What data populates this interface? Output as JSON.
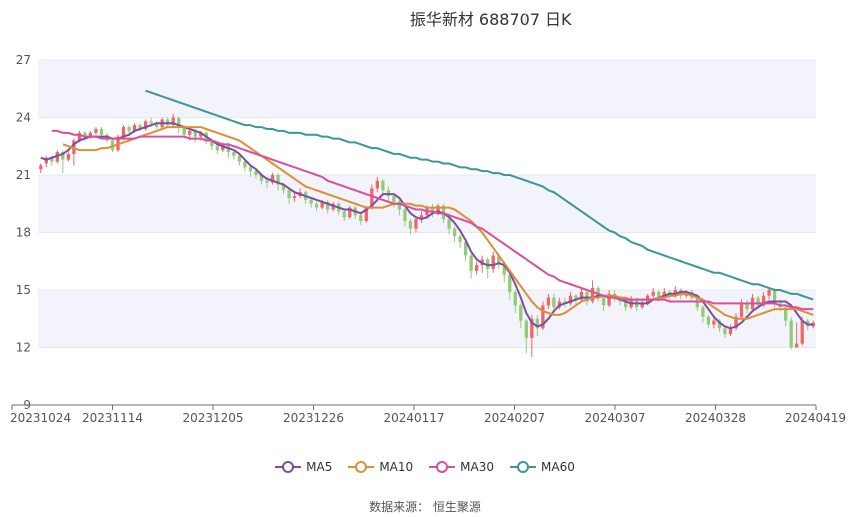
{
  "header": {
    "title": "振华新材 688707",
    "period": "日K"
  },
  "source": "数据来源： 恒生聚源",
  "colors": {
    "up": "#ee6666",
    "down": "#91cc75",
    "MA5": "#7b4ea3",
    "MA10": "#e08e35",
    "MA30": "#d94fa0",
    "MA60": "#3e9698",
    "grid_band": "#f3f4fb"
  },
  "chart_data": {
    "type": "candlestick",
    "title": "振华新材 688707",
    "subtitle": "日K",
    "ylim": [
      9,
      27
    ],
    "y_ticks": [
      "9",
      "12",
      "15",
      "18",
      "21",
      "24",
      "27"
    ],
    "x_ticks": [
      "20231024",
      "20231114",
      "20231205",
      "20231226",
      "20240117",
      "20240207",
      "20240307",
      "20240328",
      "20240419"
    ],
    "candles": [
      [
        21.3,
        21.5,
        21.1,
        21.6
      ],
      [
        21.6,
        21.9,
        21.4,
        22.0
      ],
      [
        21.9,
        21.7,
        21.5,
        22.0
      ],
      [
        21.7,
        22.2,
        21.6,
        22.3
      ],
      [
        22.2,
        21.8,
        21.1,
        22.3
      ],
      [
        21.8,
        22.1,
        21.7,
        22.3
      ],
      [
        22.1,
        22.8,
        21.5,
        22.9
      ],
      [
        22.8,
        23.2,
        22.7,
        23.3
      ],
      [
        23.2,
        23.0,
        22.8,
        23.3
      ],
      [
        23.0,
        23.2,
        22.9,
        23.3
      ],
      [
        23.2,
        23.4,
        23.1,
        23.5
      ],
      [
        23.4,
        23.1,
        22.9,
        23.5
      ],
      [
        23.1,
        22.8,
        22.7,
        23.2
      ],
      [
        22.8,
        22.3,
        22.2,
        22.9
      ],
      [
        22.3,
        23.0,
        22.2,
        23.1
      ],
      [
        23.0,
        23.5,
        22.9,
        23.6
      ],
      [
        23.5,
        23.3,
        23.1,
        23.6
      ],
      [
        23.3,
        23.6,
        23.2,
        23.7
      ],
      [
        23.6,
        23.4,
        23.3,
        23.7
      ],
      [
        23.4,
        23.8,
        23.3,
        23.9
      ],
      [
        23.8,
        23.7,
        23.5,
        24.0
      ],
      [
        23.7,
        23.5,
        23.4,
        23.8
      ],
      [
        23.5,
        23.9,
        23.4,
        24.0
      ],
      [
        23.9,
        23.6,
        23.5,
        24.0
      ],
      [
        23.6,
        24.0,
        23.5,
        24.2
      ],
      [
        24.0,
        23.5,
        23.2,
        24.0
      ],
      [
        23.5,
        23.1,
        22.9,
        23.6
      ],
      [
        23.1,
        23.3,
        22.8,
        23.4
      ],
      [
        23.3,
        23.0,
        22.7,
        23.4
      ],
      [
        23.0,
        23.2,
        22.8,
        23.3
      ],
      [
        23.2,
        22.8,
        22.6,
        23.3
      ],
      [
        22.8,
        22.5,
        22.3,
        22.9
      ],
      [
        22.5,
        22.3,
        22.1,
        22.6
      ],
      [
        22.3,
        22.6,
        22.2,
        22.7
      ],
      [
        22.6,
        22.2,
        21.9,
        22.7
      ],
      [
        22.2,
        22.0,
        21.8,
        22.3
      ],
      [
        22.0,
        21.7,
        21.5,
        22.1
      ],
      [
        21.7,
        21.4,
        21.2,
        21.8
      ],
      [
        21.4,
        21.2,
        20.9,
        21.5
      ],
      [
        21.2,
        21.0,
        20.8,
        21.3
      ],
      [
        21.0,
        20.7,
        20.5,
        21.1
      ],
      [
        20.7,
        20.6,
        20.3,
        20.9
      ],
      [
        20.6,
        21.0,
        20.5,
        21.1
      ],
      [
        21.0,
        20.5,
        20.2,
        21.1
      ],
      [
        20.5,
        20.2,
        20.0,
        20.6
      ],
      [
        20.2,
        19.8,
        19.5,
        20.3
      ],
      [
        19.8,
        19.9,
        19.6,
        20.1
      ],
      [
        19.9,
        20.1,
        19.8,
        20.3
      ],
      [
        20.1,
        19.7,
        19.5,
        20.2
      ],
      [
        19.7,
        19.5,
        19.3,
        19.8
      ],
      [
        19.5,
        19.3,
        19.1,
        19.6
      ],
      [
        19.3,
        19.6,
        19.2,
        19.7
      ],
      [
        19.6,
        19.2,
        19.0,
        19.7
      ],
      [
        19.2,
        19.5,
        19.1,
        19.6
      ],
      [
        19.5,
        19.1,
        18.9,
        19.6
      ],
      [
        19.1,
        18.8,
        18.6,
        19.2
      ],
      [
        18.8,
        19.3,
        18.7,
        19.4
      ],
      [
        19.3,
        18.9,
        18.7,
        19.4
      ],
      [
        18.9,
        18.6,
        18.4,
        19.0
      ],
      [
        18.6,
        19.3,
        18.5,
        19.4
      ],
      [
        19.3,
        20.3,
        19.2,
        20.5
      ],
      [
        20.3,
        20.7,
        20.1,
        20.9
      ],
      [
        20.7,
        20.2,
        19.9,
        20.8
      ],
      [
        20.2,
        19.9,
        19.6,
        20.4
      ],
      [
        19.9,
        19.6,
        19.3,
        20.0
      ],
      [
        19.6,
        19.2,
        18.9,
        19.7
      ],
      [
        19.2,
        18.6,
        18.3,
        19.3
      ],
      [
        18.6,
        18.2,
        17.9,
        18.7
      ],
      [
        18.2,
        18.7,
        18.0,
        18.8
      ],
      [
        18.7,
        18.9,
        18.5,
        19.1
      ],
      [
        18.9,
        19.3,
        18.7,
        19.4
      ],
      [
        19.3,
        19.0,
        18.8,
        19.5
      ],
      [
        19.0,
        19.4,
        18.9,
        19.5
      ],
      [
        19.4,
        18.7,
        18.5,
        19.5
      ],
      [
        18.7,
        18.2,
        17.9,
        18.8
      ],
      [
        18.2,
        17.8,
        17.5,
        18.3
      ],
      [
        17.8,
        17.5,
        17.2,
        17.9
      ],
      [
        17.5,
        16.8,
        16.5,
        17.6
      ],
      [
        16.8,
        16.0,
        15.6,
        16.9
      ],
      [
        16.0,
        16.3,
        15.8,
        16.5
      ],
      [
        16.3,
        16.6,
        15.9,
        16.8
      ],
      [
        16.6,
        16.1,
        15.6,
        16.7
      ],
      [
        16.1,
        16.8,
        15.9,
        17.0
      ],
      [
        16.8,
        16.4,
        16.1,
        16.9
      ],
      [
        16.4,
        15.8,
        15.4,
        16.5
      ],
      [
        15.8,
        14.9,
        14.5,
        15.9
      ],
      [
        14.9,
        14.2,
        13.8,
        15.0
      ],
      [
        14.2,
        13.4,
        13.0,
        14.3
      ],
      [
        13.4,
        12.5,
        11.7,
        13.5
      ],
      [
        12.5,
        13.5,
        11.5,
        13.7
      ],
      [
        13.5,
        13.0,
        12.6,
        13.7
      ],
      [
        13.0,
        14.2,
        12.9,
        14.4
      ],
      [
        14.2,
        14.6,
        14.0,
        14.8
      ],
      [
        14.6,
        14.1,
        13.9,
        14.8
      ],
      [
        14.1,
        14.4,
        14.0,
        14.6
      ],
      [
        14.4,
        14.3,
        14.1,
        14.6
      ],
      [
        14.3,
        14.7,
        14.2,
        14.9
      ],
      [
        14.7,
        14.5,
        14.2,
        14.8
      ],
      [
        14.5,
        14.9,
        14.4,
        15.1
      ],
      [
        14.9,
        14.4,
        14.2,
        15.0
      ],
      [
        14.4,
        15.1,
        14.3,
        15.5
      ],
      [
        15.1,
        14.6,
        14.4,
        15.2
      ],
      [
        14.6,
        14.2,
        13.9,
        14.7
      ],
      [
        14.2,
        14.8,
        14.1,
        15.0
      ],
      [
        14.8,
        14.6,
        14.4,
        15.0
      ],
      [
        14.6,
        14.4,
        14.2,
        14.7
      ],
      [
        14.4,
        14.1,
        13.9,
        14.5
      ],
      [
        14.1,
        14.5,
        14.0,
        14.7
      ],
      [
        14.5,
        14.1,
        13.9,
        14.6
      ],
      [
        14.1,
        14.3,
        14.0,
        14.5
      ],
      [
        14.3,
        14.7,
        14.2,
        14.8
      ],
      [
        14.7,
        14.9,
        14.5,
        15.1
      ],
      [
        14.9,
        14.6,
        14.4,
        15.0
      ],
      [
        14.6,
        14.9,
        14.5,
        15.1
      ],
      [
        14.9,
        14.7,
        14.5,
        15.0
      ],
      [
        14.7,
        15.0,
        14.6,
        15.2
      ],
      [
        15.0,
        14.7,
        14.5,
        15.1
      ],
      [
        14.7,
        14.9,
        14.6,
        15.0
      ],
      [
        14.9,
        14.6,
        14.4,
        15.0
      ],
      [
        14.6,
        14.1,
        13.9,
        14.7
      ],
      [
        14.1,
        13.6,
        13.3,
        14.2
      ],
      [
        13.6,
        13.2,
        13.0,
        13.7
      ],
      [
        13.2,
        13.4,
        13.0,
        13.6
      ],
      [
        13.4,
        13.0,
        12.8,
        13.5
      ],
      [
        13.0,
        12.7,
        12.5,
        13.1
      ],
      [
        12.7,
        13.0,
        12.6,
        13.2
      ],
      [
        13.0,
        13.6,
        12.9,
        13.8
      ],
      [
        13.6,
        14.3,
        13.5,
        14.5
      ],
      [
        14.3,
        14.0,
        13.8,
        14.5
      ],
      [
        14.0,
        14.6,
        13.9,
        14.8
      ],
      [
        14.6,
        14.2,
        14.0,
        14.7
      ],
      [
        14.2,
        14.7,
        14.1,
        14.9
      ],
      [
        14.7,
        15.0,
        14.5,
        15.1
      ],
      [
        15.0,
        14.3,
        14.1,
        15.1
      ],
      [
        14.3,
        14.1,
        13.9,
        14.5
      ],
      [
        14.1,
        13.4,
        13.1,
        14.2
      ],
      [
        13.4,
        12.0,
        11.9,
        13.6
      ],
      [
        12.0,
        12.2,
        12.0,
        13.3
      ],
      [
        12.2,
        13.4,
        12.1,
        13.6
      ],
      [
        13.4,
        13.1,
        12.9,
        13.5
      ],
      [
        13.1,
        13.3,
        13.0,
        13.4
      ]
    ],
    "series": [
      {
        "name": "MA5",
        "values": [
          21.9,
          21.8,
          21.9,
          22.0,
          22.1,
          22.3,
          22.6,
          22.8,
          22.9,
          23.0,
          23.0,
          23.0,
          23.0,
          22.9,
          22.9,
          23.0,
          23.1,
          23.3,
          23.4,
          23.5,
          23.6,
          23.7,
          23.7,
          23.7,
          23.7,
          23.6,
          23.5,
          23.4,
          23.3,
          23.2,
          23.0,
          22.8,
          22.6,
          22.5,
          22.4,
          22.3,
          22.1,
          21.8,
          21.5,
          21.3,
          21.0,
          20.8,
          20.7,
          20.6,
          20.5,
          20.3,
          20.1,
          20.0,
          19.9,
          19.8,
          19.7,
          19.6,
          19.5,
          19.4,
          19.3,
          19.2,
          19.2,
          19.1,
          19.0,
          19.2,
          19.4,
          19.7,
          20.0,
          20.0,
          20.0,
          19.8,
          19.4,
          19.0,
          18.8,
          18.7,
          18.8,
          19.0,
          19.1,
          19.0,
          18.8,
          18.5,
          18.1,
          17.6,
          17.0,
          16.6,
          16.4,
          16.3,
          16.3,
          16.4,
          16.3,
          15.9,
          15.3,
          14.6,
          13.8,
          13.3,
          13.1,
          13.2,
          13.5,
          13.9,
          14.2,
          14.3,
          14.4,
          14.5,
          14.6,
          14.6,
          14.6,
          14.7,
          14.7,
          14.6,
          14.6,
          14.5,
          14.4,
          14.3,
          14.3,
          14.3,
          14.3,
          14.5,
          14.6,
          14.7,
          14.8,
          14.8,
          14.9,
          14.9,
          14.8,
          14.7,
          14.4,
          14.0,
          13.6,
          13.3,
          13.1,
          13.0,
          13.1,
          13.3,
          13.6,
          13.9,
          14.1,
          14.3,
          14.4,
          14.4,
          14.4,
          14.4,
          14.2,
          13.8,
          13.4,
          13.2,
          13.2
        ]
      },
      {
        "name": "MA10",
        "values": [
          22.6,
          22.5,
          22.4,
          22.3,
          22.3,
          22.3,
          22.3,
          22.4,
          22.4,
          22.5,
          22.6,
          22.7,
          22.8,
          22.9,
          23.0,
          23.1,
          23.2,
          23.3,
          23.4,
          23.5,
          23.5,
          23.5,
          23.5,
          23.5,
          23.5,
          23.5,
          23.4,
          23.3,
          23.2,
          23.1,
          23.0,
          22.9,
          22.8,
          22.6,
          22.4,
          22.2,
          22.0,
          21.8,
          21.6,
          21.4,
          21.2,
          21.0,
          20.8,
          20.6,
          20.4,
          20.3,
          20.2,
          20.1,
          20.0,
          19.9,
          19.8,
          19.7,
          19.6,
          19.5,
          19.4,
          19.3,
          19.3,
          19.3,
          19.3,
          19.4,
          19.5,
          19.5,
          19.5,
          19.5,
          19.4,
          19.4,
          19.3,
          19.3,
          19.3,
          19.3,
          19.3,
          19.2,
          19.0,
          18.8,
          18.6,
          18.3,
          18.0,
          17.6,
          17.2,
          16.8,
          16.4,
          16.0,
          15.6,
          15.2,
          14.8,
          14.4,
          14.1,
          13.9,
          13.8,
          13.7,
          13.7,
          13.8,
          14.0,
          14.2,
          14.4,
          14.5,
          14.6,
          14.6,
          14.7,
          14.7,
          14.7,
          14.6,
          14.6,
          14.5,
          14.5,
          14.5,
          14.5,
          14.5,
          14.6,
          14.6,
          14.7,
          14.7,
          14.8,
          14.8,
          14.7,
          14.6,
          14.5,
          14.3,
          14.1,
          13.9,
          13.7,
          13.6,
          13.5,
          13.5,
          13.5,
          13.6,
          13.7,
          13.8,
          13.9,
          14.0,
          14.0,
          14.0,
          14.0,
          14.0,
          13.9,
          13.8,
          13.7
        ]
      },
      {
        "name": "MA30",
        "values": [
          23.3,
          23.3,
          23.2,
          23.2,
          23.1,
          23.1,
          23.0,
          23.0,
          23.0,
          22.9,
          22.9,
          22.9,
          22.9,
          22.9,
          22.9,
          22.9,
          23.0,
          23.0,
          23.0,
          23.0,
          23.0,
          23.0,
          23.0,
          23.0,
          23.0,
          22.9,
          22.9,
          22.9,
          22.8,
          22.8,
          22.7,
          22.6,
          22.6,
          22.5,
          22.4,
          22.3,
          22.2,
          22.1,
          22.0,
          21.9,
          21.8,
          21.7,
          21.6,
          21.5,
          21.4,
          21.3,
          21.2,
          21.1,
          21.0,
          20.9,
          20.7,
          20.6,
          20.5,
          20.4,
          20.3,
          20.2,
          20.1,
          20.0,
          19.9,
          19.8,
          19.7,
          19.6,
          19.5,
          19.5,
          19.4,
          19.3,
          19.2,
          19.2,
          19.1,
          19.1,
          19.0,
          19.0,
          18.9,
          18.8,
          18.7,
          18.6,
          18.5,
          18.3,
          18.2,
          18.0,
          17.8,
          17.6,
          17.4,
          17.2,
          17.0,
          16.8,
          16.6,
          16.4,
          16.2,
          16.0,
          15.8,
          15.7,
          15.5,
          15.4,
          15.3,
          15.2,
          15.1,
          15.0,
          14.9,
          14.8,
          14.7,
          14.6,
          14.6,
          14.5,
          14.5,
          14.5,
          14.5,
          14.5,
          14.5,
          14.5,
          14.5,
          14.5,
          14.4,
          14.4,
          14.4,
          14.4,
          14.4,
          14.4,
          14.4,
          14.4,
          14.3,
          14.3,
          14.3,
          14.3,
          14.3,
          14.3,
          14.3,
          14.3,
          14.3,
          14.3,
          14.3,
          14.3,
          14.2,
          14.2,
          14.1,
          14.1,
          14.0,
          14.0,
          14.0
        ]
      },
      {
        "name": "MA60",
        "values": [
          25.4,
          25.3,
          25.2,
          25.1,
          25.0,
          24.9,
          24.8,
          24.7,
          24.6,
          24.5,
          24.4,
          24.3,
          24.2,
          24.1,
          24.0,
          23.9,
          23.8,
          23.7,
          23.6,
          23.6,
          23.5,
          23.5,
          23.4,
          23.4,
          23.3,
          23.3,
          23.2,
          23.2,
          23.2,
          23.1,
          23.1,
          23.1,
          23.0,
          23.0,
          22.9,
          22.9,
          22.8,
          22.7,
          22.7,
          22.6,
          22.5,
          22.4,
          22.4,
          22.3,
          22.2,
          22.1,
          22.1,
          22.0,
          21.9,
          21.9,
          21.8,
          21.8,
          21.7,
          21.7,
          21.6,
          21.6,
          21.5,
          21.4,
          21.4,
          21.3,
          21.3,
          21.2,
          21.2,
          21.1,
          21.1,
          21.0,
          21.0,
          20.9,
          20.8,
          20.7,
          20.6,
          20.5,
          20.4,
          20.2,
          20.1,
          19.9,
          19.7,
          19.5,
          19.3,
          19.1,
          18.9,
          18.7,
          18.5,
          18.3,
          18.1,
          18.0,
          17.8,
          17.7,
          17.5,
          17.4,
          17.3,
          17.1,
          17.0,
          16.9,
          16.8,
          16.7,
          16.6,
          16.5,
          16.4,
          16.3,
          16.2,
          16.1,
          16.0,
          15.9,
          15.9,
          15.8,
          15.7,
          15.6,
          15.5,
          15.4,
          15.3,
          15.3,
          15.2,
          15.1,
          15.0,
          15.0,
          14.9,
          14.8,
          14.8,
          14.7,
          14.6,
          14.5
        ]
      }
    ],
    "legend": [
      "MA5",
      "MA10",
      "MA30",
      "MA60"
    ],
    "legend_position": "bottom-center",
    "grid": true
  }
}
